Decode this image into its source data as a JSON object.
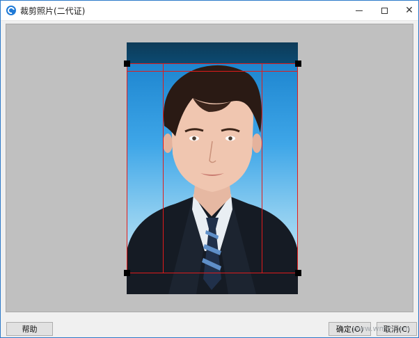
{
  "window": {
    "title": "裁剪照片(二代证)",
    "minimize_glyph": "—",
    "maximize_glyph": "☐",
    "close_glyph": "✕"
  },
  "buttons": {
    "help_label": "帮助",
    "ok_label": "确定(O)",
    "cancel_label": "取消(C)"
  },
  "watermark": "www.wm2.com",
  "colors": {
    "canvas_bg": "#c0c0c0",
    "crop_line": "#e11b1b",
    "title_icon": "#1f7ad6"
  }
}
